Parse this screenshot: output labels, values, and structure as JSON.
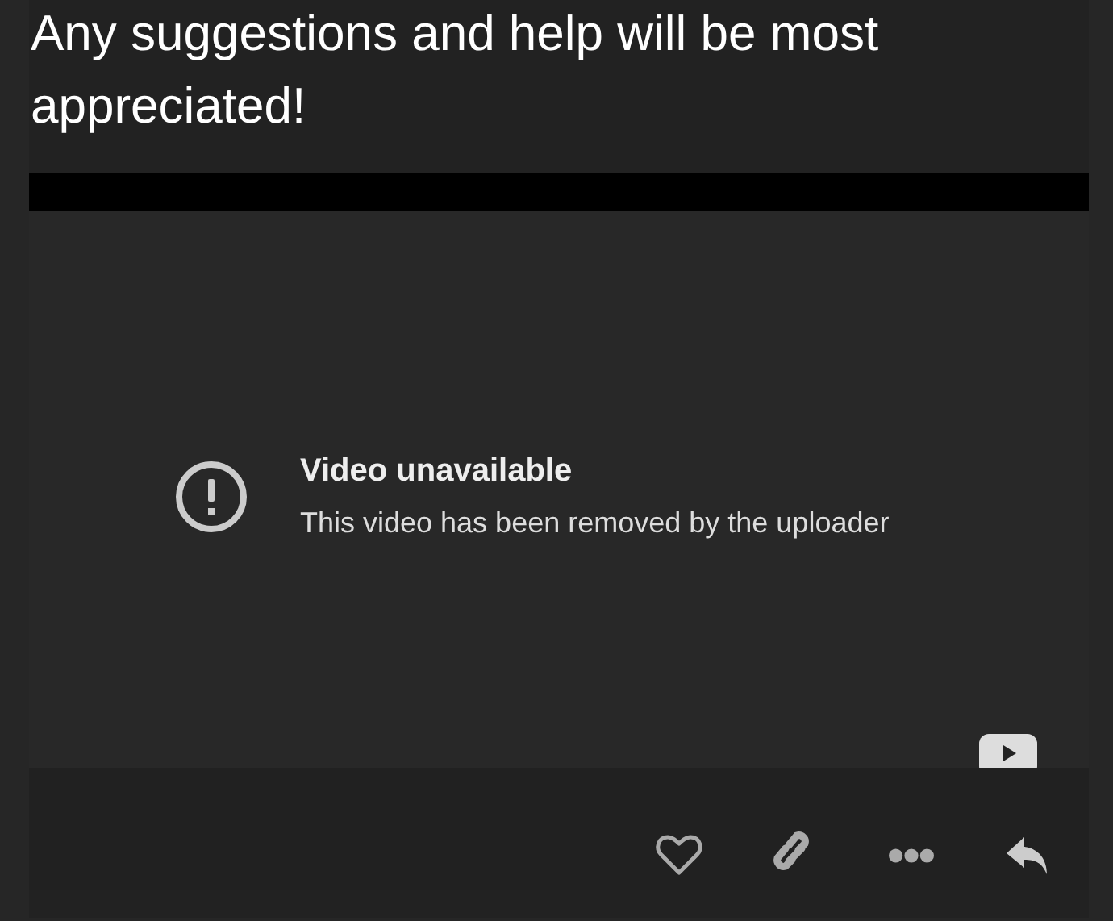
{
  "post": {
    "text": "Any suggestions and help will be most appreciated!"
  },
  "video": {
    "title": "Video unavailable",
    "message": "This video has been removed by the uploader"
  },
  "actions": [
    {
      "kind": "like"
    },
    {
      "kind": "link"
    },
    {
      "kind": "more"
    },
    {
      "kind": "reply"
    }
  ]
}
